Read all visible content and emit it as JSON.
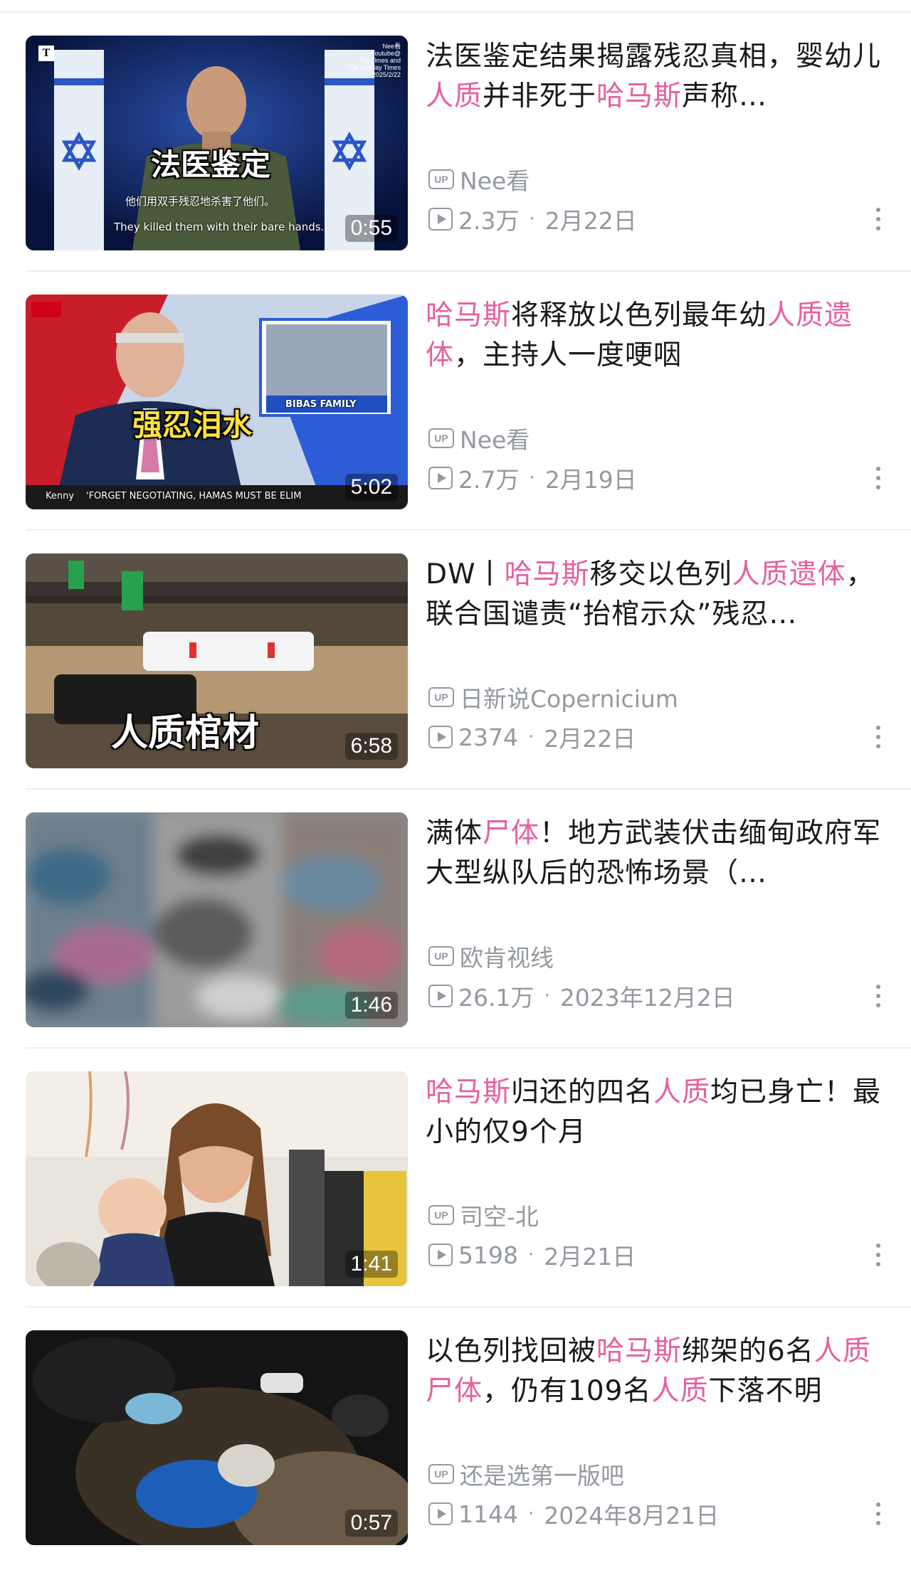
{
  "videos": [
    {
      "title_parts": [
        {
          "text": "法医鉴定结果揭露残忍真相，婴幼儿",
          "hl": false
        },
        {
          "text": "人质",
          "hl": true
        },
        {
          "text": "并非死于",
          "hl": false
        },
        {
          "text": "哈马斯",
          "hl": true
        },
        {
          "text": "声称…",
          "hl": false
        }
      ],
      "uploader": "Nee看",
      "views": "2.3万",
      "date": "2月22日",
      "duration": "0:55",
      "thumb_caption": "法医鉴定",
      "thumb_sub_zh": "他们用双手残忍地杀害了他们。",
      "thumb_sub_en": "They killed them with their bare hands.",
      "thumb_watermark": "Nee看\nYoutube@\nThe Times and\nThe Sunday Times\n2025/2/22"
    },
    {
      "title_parts": [
        {
          "text": "哈马斯",
          "hl": true
        },
        {
          "text": "将释放以色列最年幼",
          "hl": false
        },
        {
          "text": "人质遗体",
          "hl": true
        },
        {
          "text": "，主持人一度哽咽",
          "hl": false
        }
      ],
      "uploader": "Nee看",
      "views": "2.7万",
      "date": "2月19日",
      "duration": "5:02",
      "thumb_caption": "强忍泪水",
      "thumb_inset": "BIBAS FAMILY",
      "thumb_ticker": "'FORGET NEGOTIATING, HAMAS MUST BE ELIM",
      "thumb_ticker_name": "Kenny"
    },
    {
      "title_parts": [
        {
          "text": "DW丨",
          "hl": false
        },
        {
          "text": "哈马斯",
          "hl": true
        },
        {
          "text": "移交以色列",
          "hl": false
        },
        {
          "text": "人质遗体",
          "hl": true
        },
        {
          "text": "，联合国谴责“抬棺示众”残忍…",
          "hl": false
        }
      ],
      "uploader": "日新说Copernicium",
      "views": "2374",
      "date": "2月22日",
      "duration": "6:58",
      "thumb_caption": "人质棺材"
    },
    {
      "title_parts": [
        {
          "text": "满体",
          "hl": false
        },
        {
          "text": "尸体",
          "hl": true
        },
        {
          "text": "！地方武装伏击缅甸政府军大型纵队后的恐怖场景（…",
          "hl": false
        }
      ],
      "uploader": "欧肯视线",
      "views": "26.1万",
      "date": "2023年12月2日",
      "duration": "1:46"
    },
    {
      "title_parts": [
        {
          "text": "哈马斯",
          "hl": true
        },
        {
          "text": "归还的四名",
          "hl": false
        },
        {
          "text": "人质",
          "hl": true
        },
        {
          "text": "均已身亡！最小的仅9个月",
          "hl": false
        }
      ],
      "uploader": "司空-北",
      "views": "5198",
      "date": "2月21日",
      "duration": "1:41"
    },
    {
      "title_parts": [
        {
          "text": "以色列找回被",
          "hl": false
        },
        {
          "text": "哈马斯",
          "hl": true
        },
        {
          "text": "绑架的6名",
          "hl": false
        },
        {
          "text": "人质尸体",
          "hl": true
        },
        {
          "text": "，仍有109名",
          "hl": false
        },
        {
          "text": "人质",
          "hl": true
        },
        {
          "text": "下落不明",
          "hl": false
        }
      ],
      "uploader": "还是选第一版吧",
      "views": "1144",
      "date": "2024年8月21日",
      "duration": "0:57"
    }
  ],
  "labels": {
    "up_badge": "UP",
    "separator": "·"
  },
  "colors": {
    "highlight": "#e5609e",
    "meta": "#9499a0",
    "title": "#18191c",
    "divider": "#eceef0"
  },
  "icons": {
    "uploader": "up-badge-icon",
    "views": "play-count-icon",
    "more": "more-vertical-icon"
  }
}
